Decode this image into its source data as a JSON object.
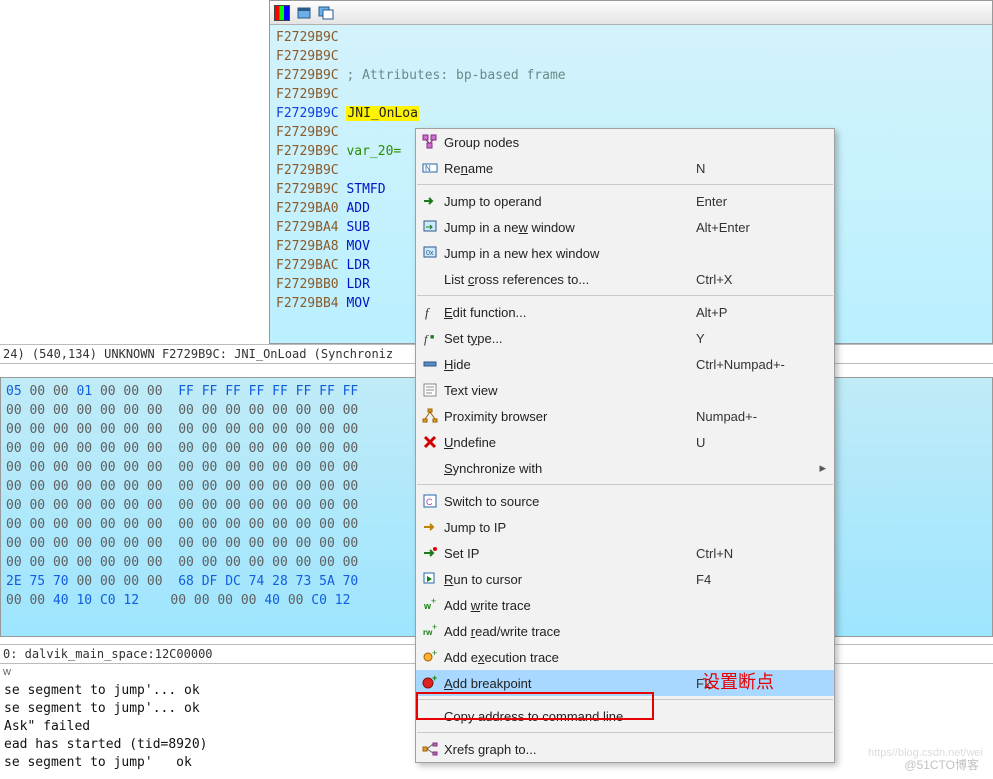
{
  "disasm": {
    "lines": [
      {
        "addr": "F2729B9C",
        "cls": "addr",
        "rest": ""
      },
      {
        "addr": "F2729B9C",
        "cls": "addr",
        "rest": ""
      },
      {
        "addr": "F2729B9C",
        "cls": "addr",
        "rest_comment": "; Attributes: bp-based frame"
      },
      {
        "addr": "F2729B9C",
        "cls": "addr",
        "rest": ""
      },
      {
        "addr": "F2729B9C",
        "cls": "addr-blue",
        "func": "JNI_OnLoa"
      },
      {
        "addr": "F2729B9C",
        "cls": "addr",
        "rest": ""
      },
      {
        "addr": "F2729B9C",
        "cls": "addr",
        "var": "var_20="
      },
      {
        "addr": "F2729B9C",
        "cls": "addr",
        "rest": ""
      },
      {
        "addr": "F2729B9C",
        "cls": "addr",
        "instr": "STMFD"
      },
      {
        "addr": "F2729BA0",
        "cls": "addr",
        "instr": "ADD"
      },
      {
        "addr": "F2729BA4",
        "cls": "addr",
        "instr": "SUB"
      },
      {
        "addr": "F2729BA8",
        "cls": "addr",
        "instr": "MOV"
      },
      {
        "addr": "F2729BAC",
        "cls": "addr",
        "instr": "LDR"
      },
      {
        "addr": "F2729BB0",
        "cls": "addr",
        "instr": "LDR"
      },
      {
        "addr": "F2729BB4",
        "cls": "addr",
        "instr": "MOV"
      }
    ]
  },
  "status": "24) (540,134) UNKNOWN F2729B9C: JNI_OnLoad (Synchroniz",
  "hex": {
    "lines": [
      "05 00 00 01 00 00 00  FF FF FF FF FF FF FF FF",
      "00 00 00 00 00 00 00  00 00 00 00 00 00 00 00",
      "00 00 00 00 00 00 00  00 00 00 00 00 00 00 00",
      "00 00 00 00 00 00 00  00 00 00 00 00 00 00 00",
      "00 00 00 00 00 00 00  00 00 00 00 00 00 00 00",
      "00 00 00 00 00 00 00  00 00 00 00 00 00 00 00",
      "00 00 00 00 00 00 00  00 00 00 00 00 00 00 00",
      "00 00 00 00 00 00 00  00 00 00 00 00 00 00 00",
      "00 00 00 00 00 00 00  00 00 00 00 00 00 00 00",
      "00 00 00 00 00 00 00  00 00 00 00 00 00 00 00",
      "2E 75 70 00 00 00 00  68 DF DC 74 28 73 5A 70",
      "00 00 40 10 C0 12    00 00 00 00 40 00 C0 12"
    ]
  },
  "hex_status": "0: dalvik_main_space:12C00000",
  "output_title": "w",
  "output": [
    "se segment to jump'... ok",
    "se segment to jump'... ok",
    "Ask\" failed",
    "ead has started (tid=8920)",
    "se segment to jump'   ok"
  ],
  "menu": {
    "items": [
      {
        "icon": "group-nodes-icon",
        "label": "Group nodes",
        "shortcut": ""
      },
      {
        "icon": "rename-icon",
        "label": "Re<u>n</u>ame",
        "shortcut": "N"
      },
      {
        "sep": true
      },
      {
        "icon": "jump-operand-icon",
        "label": "Jump to operand",
        "shortcut": "Enter"
      },
      {
        "icon": "jump-newwin-icon",
        "label": "Jump in a ne<u>w</u> window",
        "shortcut": "Alt+Enter"
      },
      {
        "icon": "jump-hex-icon",
        "label": "Jump in a new hex window",
        "shortcut": ""
      },
      {
        "icon": "",
        "label": "List <u>c</u>ross references to...",
        "shortcut": "Ctrl+X"
      },
      {
        "sep": true
      },
      {
        "icon": "edit-func-icon",
        "label": "<u>E</u>dit function...",
        "shortcut": "Alt+P"
      },
      {
        "icon": "set-type-icon",
        "label": "Set t<u>y</u>pe...",
        "shortcut": "Y"
      },
      {
        "icon": "hide-icon",
        "label": "<u>H</u>ide",
        "shortcut": "Ctrl+Numpad+-"
      },
      {
        "icon": "text-view-icon",
        "label": "Text view",
        "shortcut": ""
      },
      {
        "icon": "proximity-icon",
        "label": "Proximity browser",
        "shortcut": "Numpad+-"
      },
      {
        "icon": "undefine-icon",
        "label": "<u>U</u>ndefine",
        "shortcut": "U"
      },
      {
        "icon": "",
        "label": "<u>S</u>ynchronize with",
        "shortcut": "",
        "submenu": true
      },
      {
        "sep": true
      },
      {
        "icon": "switch-source-icon",
        "label": "Switch to source",
        "shortcut": ""
      },
      {
        "icon": "jump-ip-icon",
        "label": "Jump to IP",
        "shortcut": ""
      },
      {
        "icon": "set-ip-icon",
        "label": "Set IP",
        "shortcut": "Ctrl+N"
      },
      {
        "icon": "run-cursor-icon",
        "label": "<u>R</u>un to cursor",
        "shortcut": "F4"
      },
      {
        "icon": "write-trace-icon",
        "label": "Add <u>w</u>rite trace",
        "shortcut": ""
      },
      {
        "icon": "rw-trace-icon",
        "label": "Add <u>r</u>ead/write trace",
        "shortcut": ""
      },
      {
        "icon": "exec-trace-icon",
        "label": "Add e<u>x</u>ecution trace",
        "shortcut": ""
      },
      {
        "icon": "breakpoint-icon",
        "label": "<u>A</u>dd breakpoint",
        "shortcut": "F2",
        "highlight": true
      },
      {
        "sep": true
      },
      {
        "icon": "",
        "label": "Copy address to command line",
        "shortcut": ""
      },
      {
        "sep": true
      },
      {
        "icon": "xrefs-graph-icon",
        "label": "Xrefs graph to...",
        "shortcut": ""
      }
    ]
  },
  "red_label": "设置断点",
  "watermark1": "@51CTO博客",
  "watermark2": "https//blog.csdn.net/wei"
}
